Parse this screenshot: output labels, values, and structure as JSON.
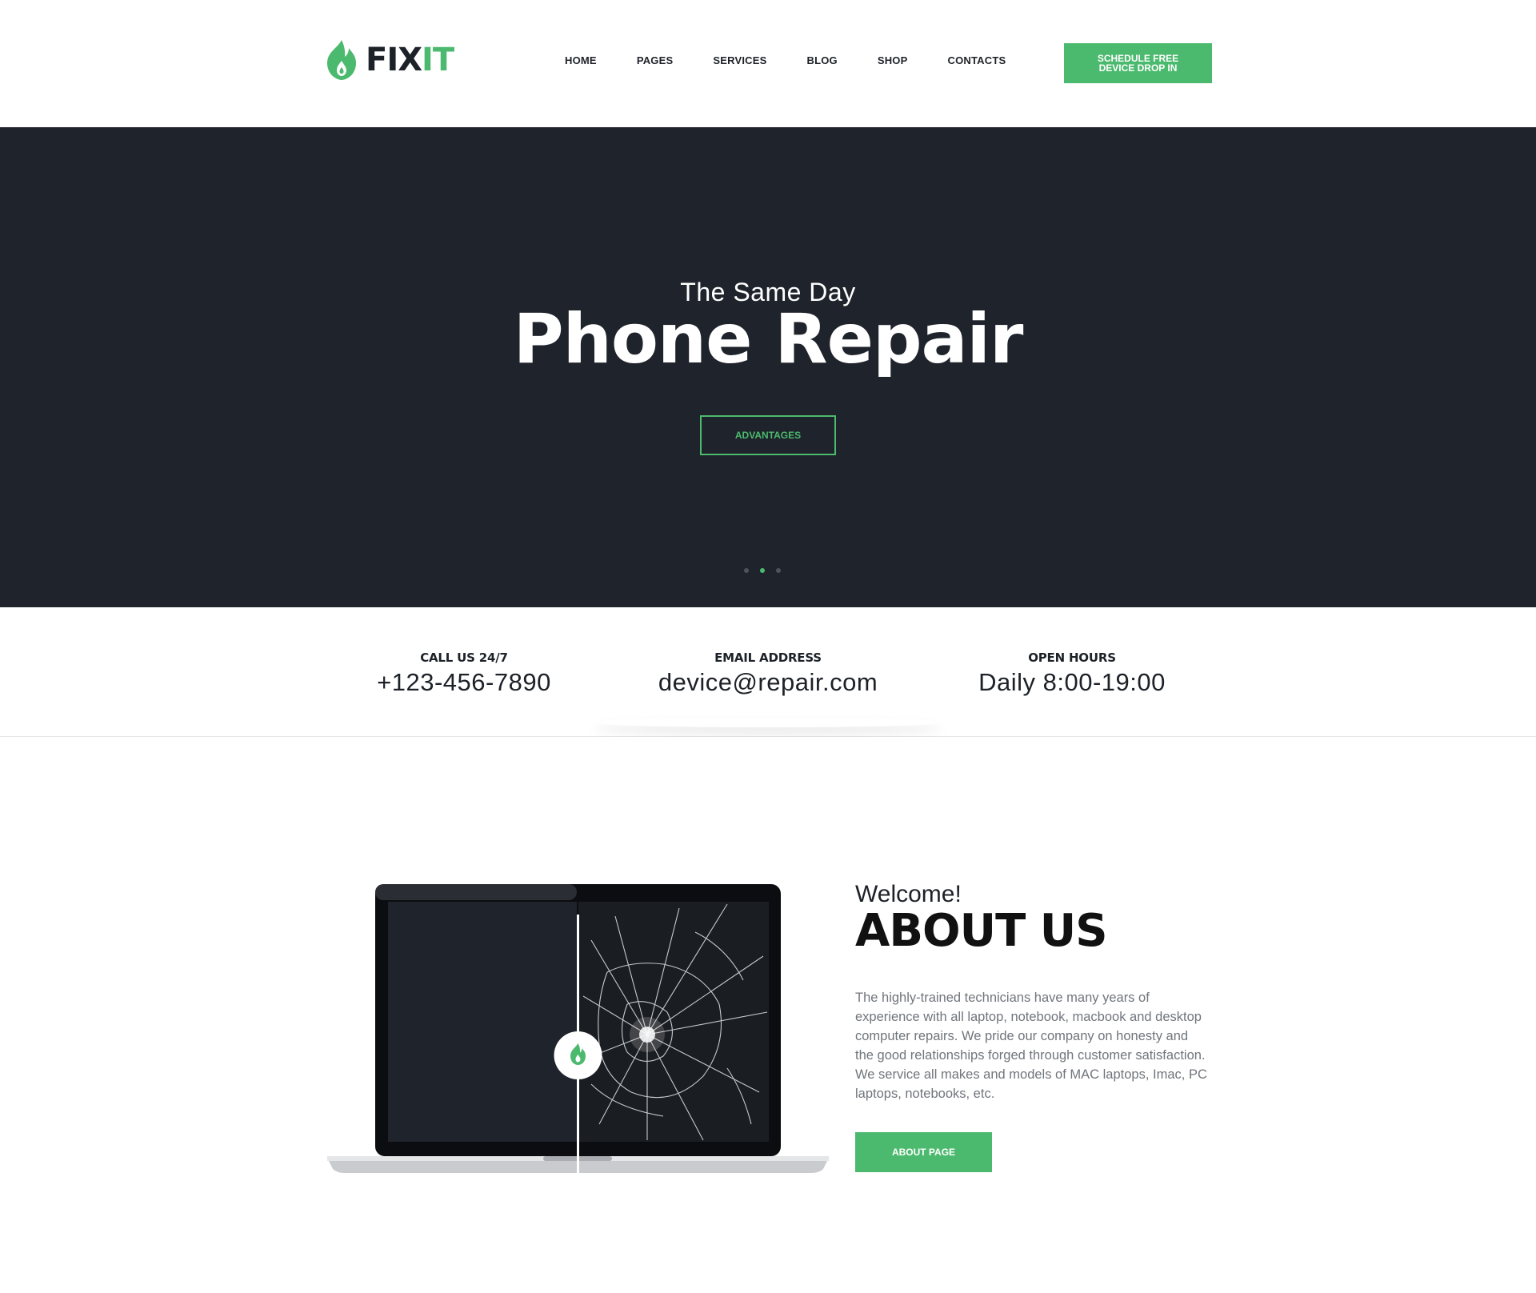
{
  "brand": {
    "name_part1": "FIX",
    "name_part2": "IT",
    "accent": "#4cba6e",
    "dark": "#1f232b"
  },
  "nav": {
    "items": [
      "HOME",
      "PAGES",
      "SERVICES",
      "BLOG",
      "SHOP",
      "CONTACTS"
    ]
  },
  "header": {
    "cta_label": "SCHEDULE FREE DEVICE DROP IN"
  },
  "hero": {
    "subtitle": "The Same Day",
    "title": "Phone Repair",
    "button_label": "ADVANTAGES",
    "slides_count": 3,
    "active_slide": 2
  },
  "info": [
    {
      "label": "CALL US 24/7",
      "value": "+123-456-7890"
    },
    {
      "label": "EMAIL ADDRESS",
      "value": "device@repair.com"
    },
    {
      "label": "OPEN HOURS",
      "value": "Daily 8:00-19:00"
    }
  ],
  "about": {
    "subtitle": "Welcome!",
    "title": "ABOUT US",
    "text": "The highly-trained technicians have many years of experience with all laptop, notebook, macbook and desktop computer repairs. We pride our company on honesty and the good relationships forged through customer satisfaction. We service all makes and models of MAC laptops, Imac, PC laptops, notebooks, etc.",
    "button_label": "ABOUT PAGE"
  },
  "icons": {
    "logo": "flame-icon",
    "compare_handle": "flame-icon"
  }
}
